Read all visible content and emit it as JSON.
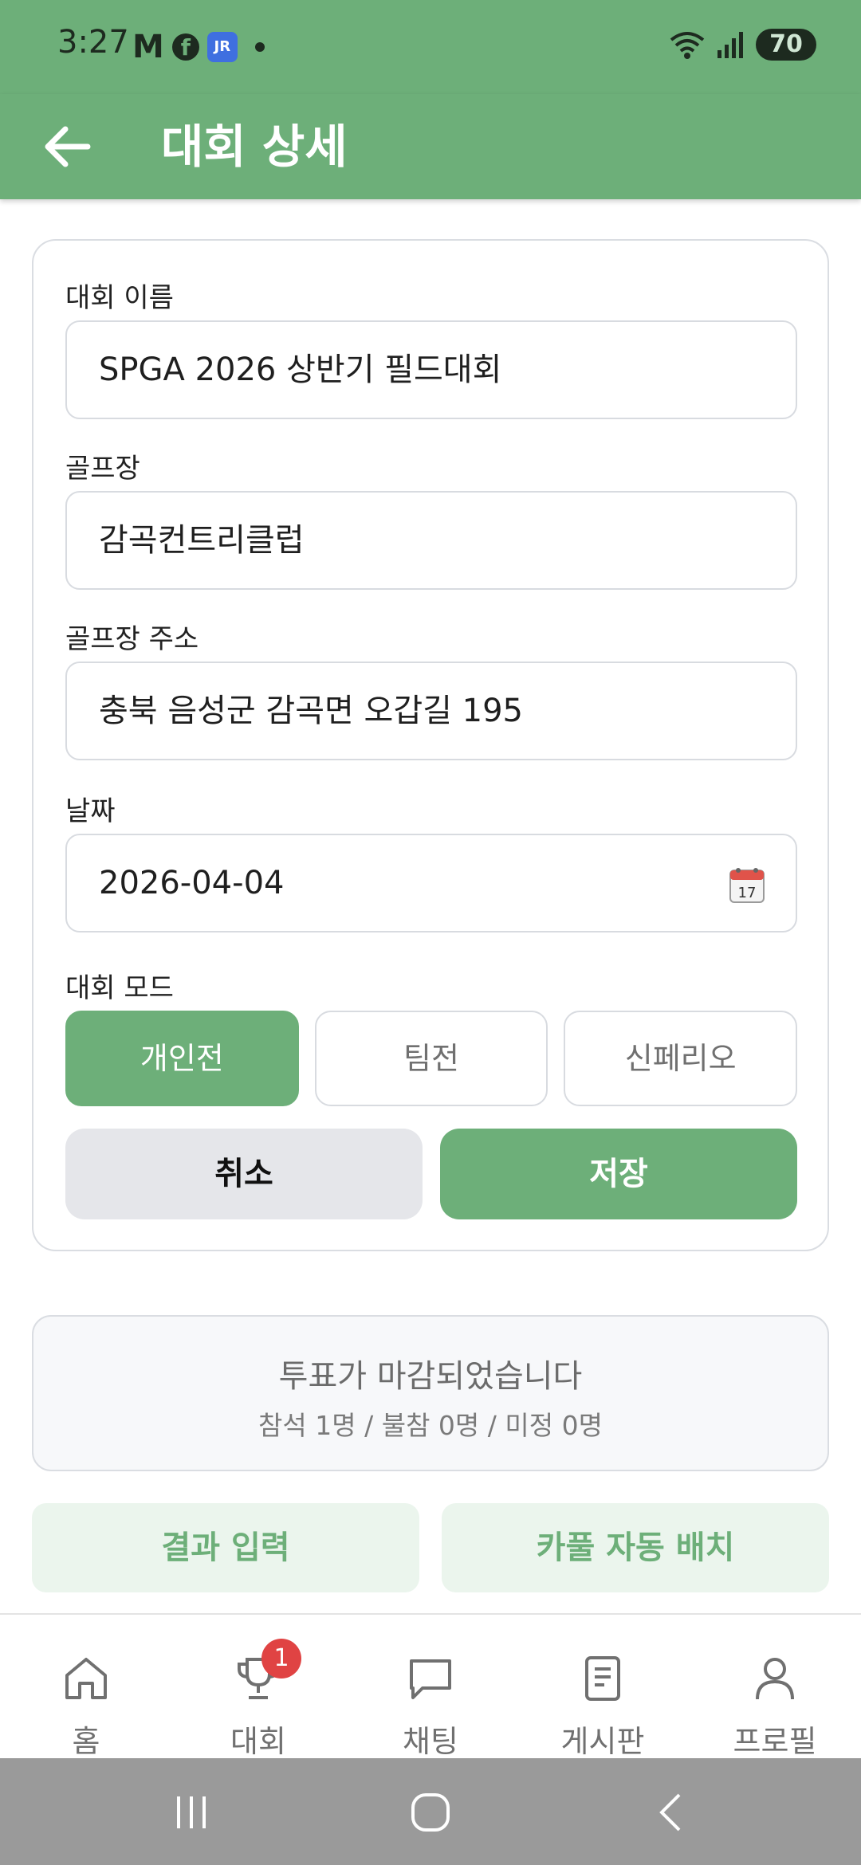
{
  "status_bar": {
    "time": "3:27",
    "notif_m": "M",
    "notif_fb": "f",
    "notif_app": "JR",
    "battery": "70"
  },
  "app_bar": {
    "title": "대회 상세",
    "back_icon": "arrow-left-icon"
  },
  "form": {
    "name_label": "대회 이름",
    "name_value": "SPGA 2026 상반기 필드대회",
    "course_label": "골프장",
    "course_value": "감곡컨트리클럽",
    "address_label": "골프장 주소",
    "address_value": "충북 음성군 감곡면 오갑길 195",
    "date_label": "날짜",
    "date_value": "2026-04-04",
    "calendar_day": "17",
    "mode_label": "대회 모드",
    "modes": [
      {
        "label": "개인전",
        "active": true
      },
      {
        "label": "팀전",
        "active": false
      },
      {
        "label": "신페리오",
        "active": false
      }
    ],
    "cancel_label": "취소",
    "save_label": "저장"
  },
  "vote": {
    "title": "투표가 마감되었습니다",
    "counts": "참석 1명 / 불참 0명 / 미정 0명"
  },
  "actions": {
    "results_label": "결과 입력",
    "carpool_label": "카풀 자동 배치"
  },
  "bottom_nav": {
    "items": [
      {
        "label": "홈",
        "icon": "home-icon"
      },
      {
        "label": "대회",
        "icon": "trophy-icon",
        "badge": "1"
      },
      {
        "label": "채팅",
        "icon": "chat-icon"
      },
      {
        "label": "게시판",
        "icon": "board-icon"
      },
      {
        "label": "프로필",
        "icon": "profile-icon"
      }
    ]
  },
  "colors": {
    "primary": "#6daf79",
    "primary_light": "#ebf5ed",
    "badge": "#e04343"
  }
}
